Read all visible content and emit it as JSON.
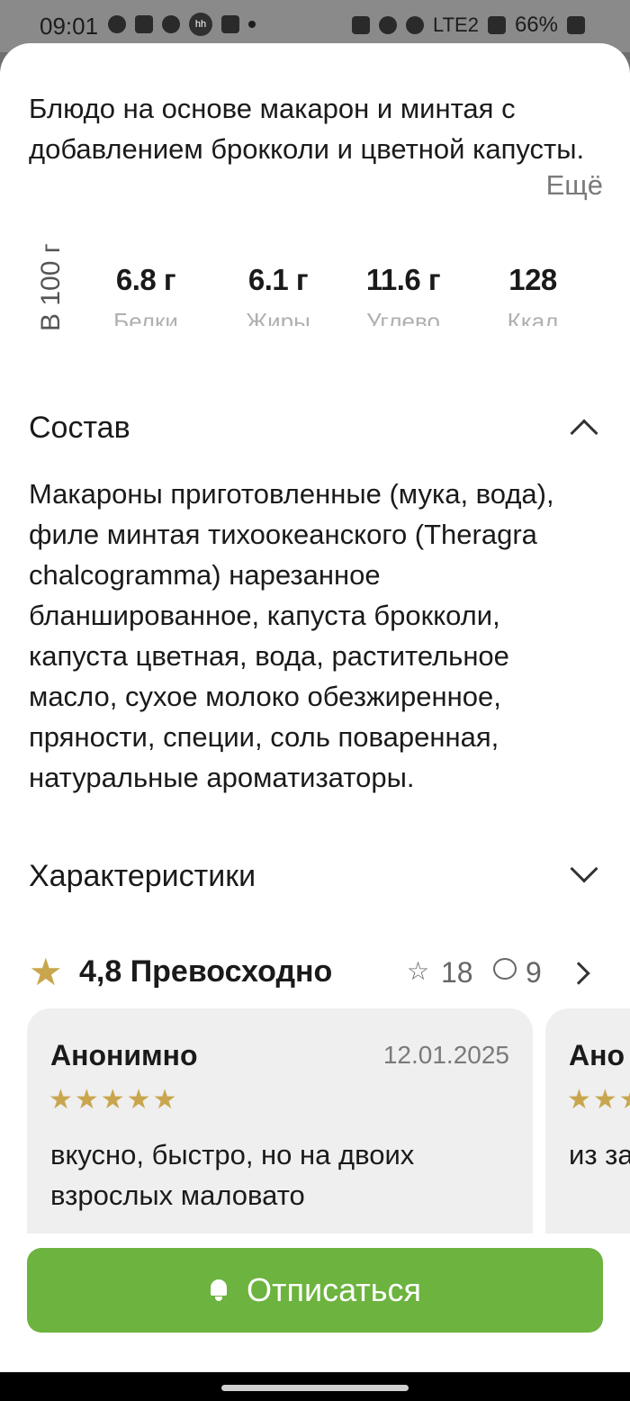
{
  "status_bar": {
    "time": "09:01",
    "battery": "66%",
    "network": "LTE2"
  },
  "product": {
    "description": "Блюдо на основе макарон и минтая с добавлением брокколи и цветной капусты.",
    "more_label": "Ещё"
  },
  "nutrition": {
    "per_label": "В 100 г",
    "items": [
      {
        "value": "6.8 г",
        "label": "Белки"
      },
      {
        "value": "6.1 г",
        "label": "Жиры"
      },
      {
        "value": "11.6 г",
        "label": "Углево"
      },
      {
        "value": "128",
        "label": "Ккал"
      }
    ]
  },
  "composition": {
    "title": "Состав",
    "text": "Макароны приготовленные (мука, вода), филе минтая тихоокеанского (Theragra chalcogramma) нарезанное бланшированное, капуста брокколи, капуста цветная, вода, растительное масло, сухое молоко обезжиренное, пряности, специи, соль поваренная, натуральные ароматизаторы."
  },
  "characteristics": {
    "title": "Характеристики"
  },
  "rating": {
    "summary": "4,8 Превосходно",
    "ratings_count": "18",
    "reviews_count": "9"
  },
  "reviews": [
    {
      "author": "Анонимно",
      "date": "12.01.2025",
      "stars": 5,
      "stars_text": "★★★★★",
      "text": "вкусно, быстро, но на двоих взрослых маловато"
    },
    {
      "author": "Ано",
      "date": "",
      "stars_text": "★★★",
      "text": "из за это с дво"
    }
  ],
  "actions": {
    "unsubscribe_label": "Отписаться"
  },
  "colors": {
    "accent_green": "#6db33f",
    "star_gold": "#c9a64d"
  }
}
